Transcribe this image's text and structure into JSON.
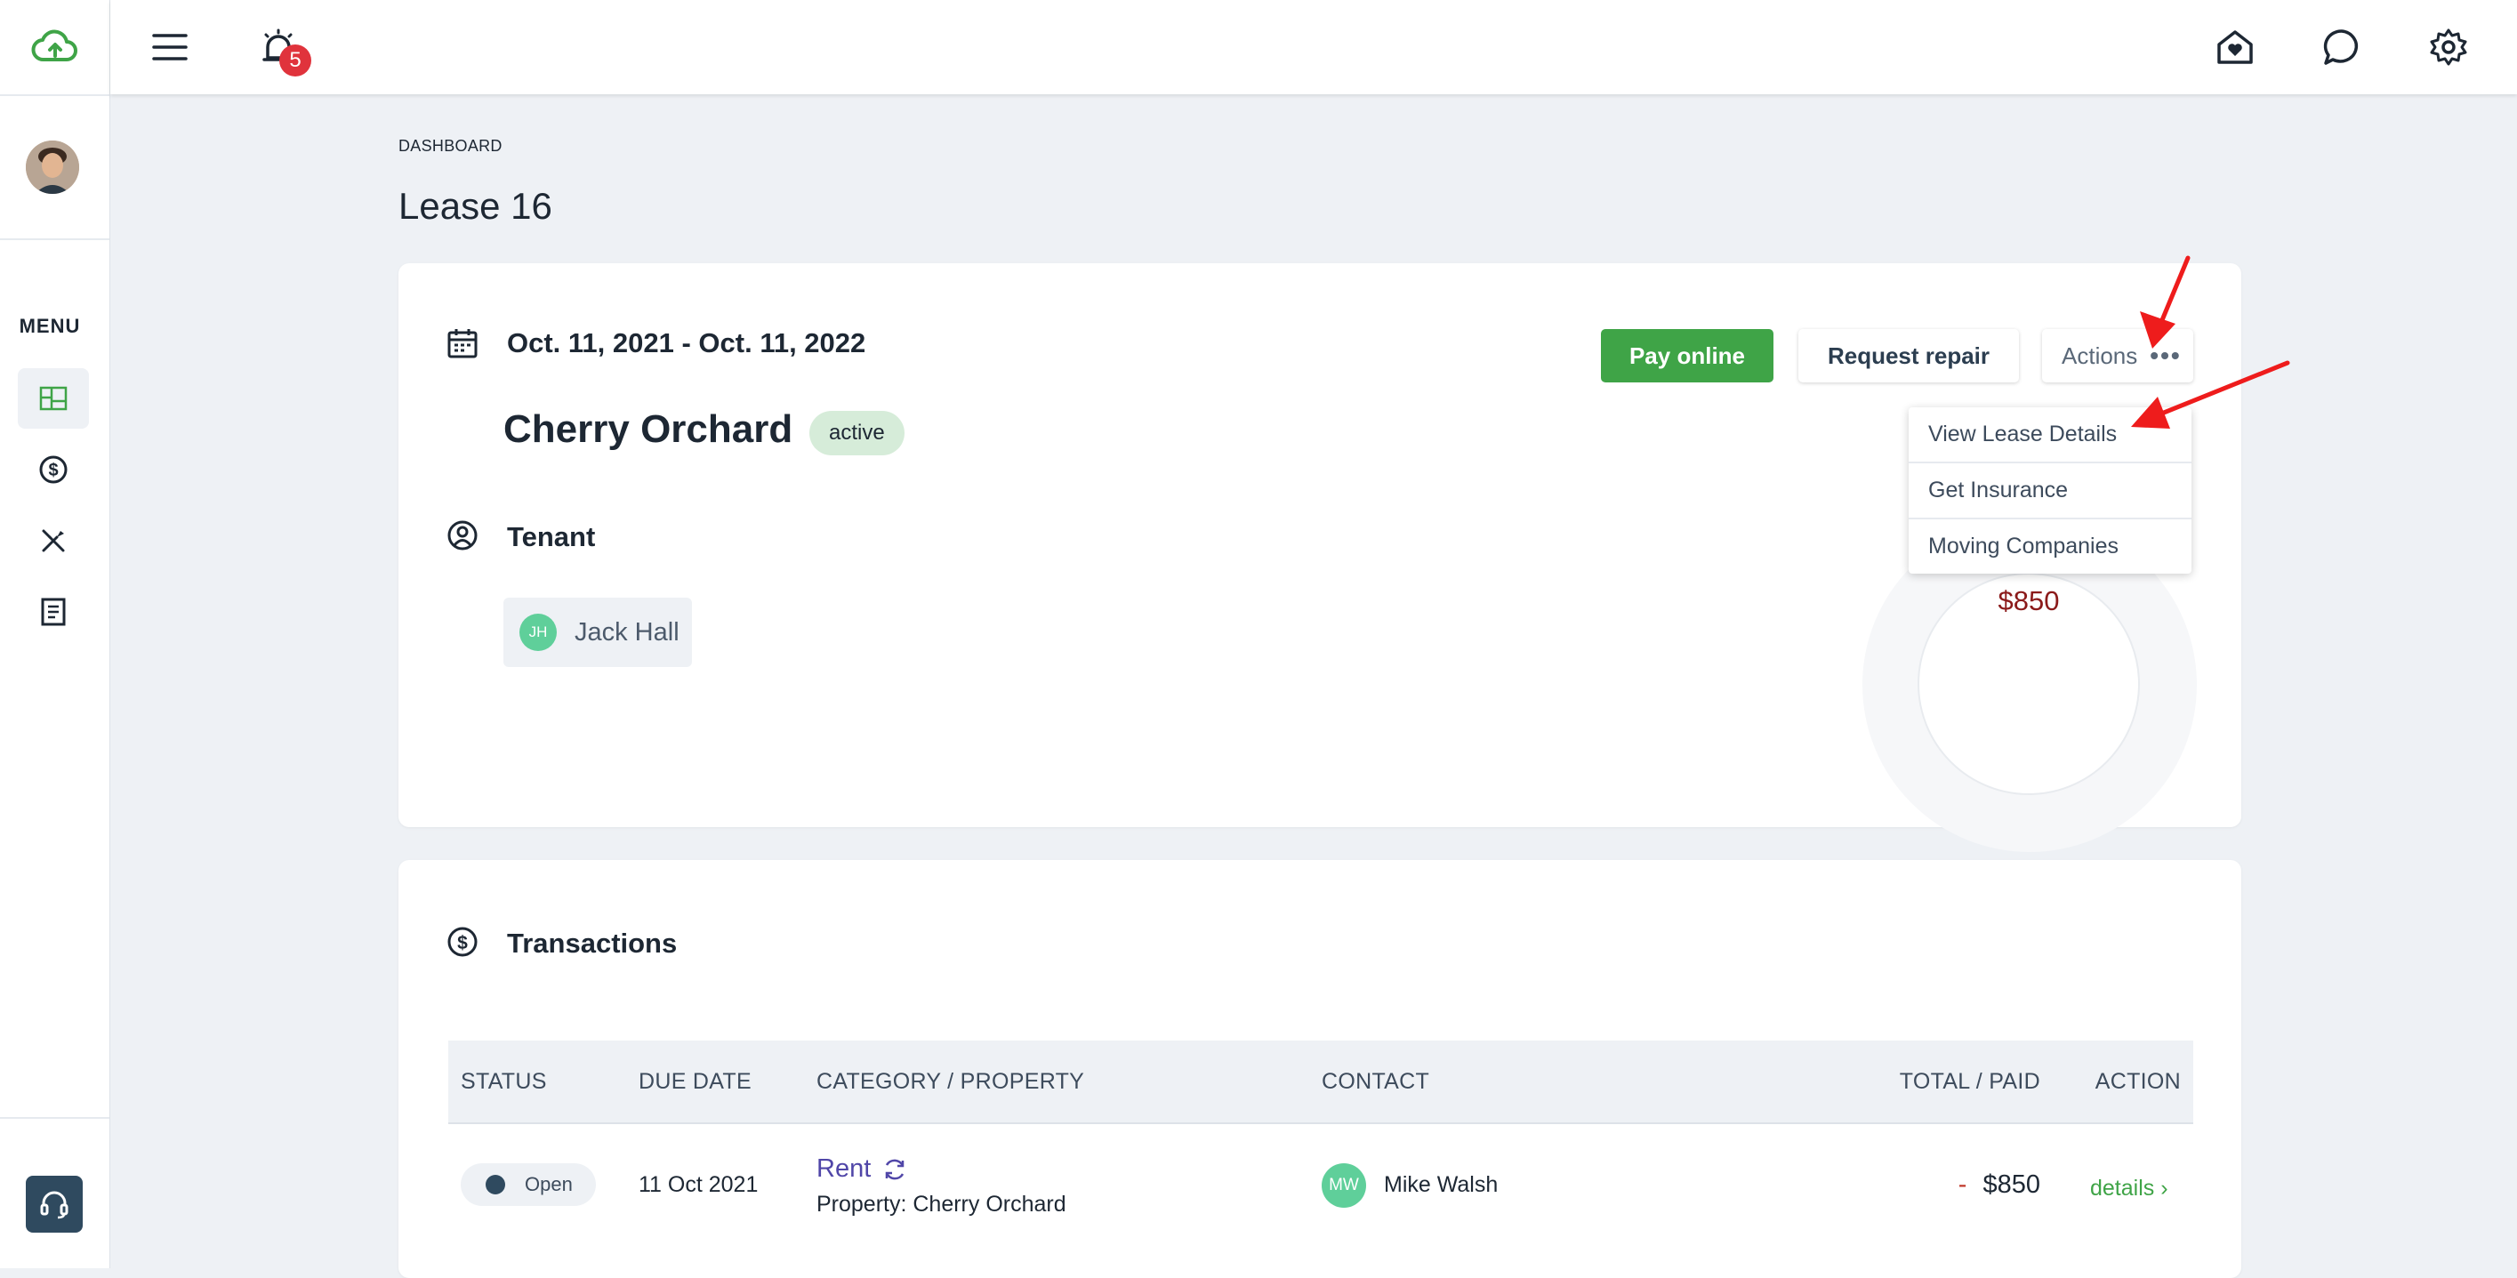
{
  "topbar": {
    "notification_count": "5"
  },
  "sidebar": {
    "menu_label": "MENU"
  },
  "breadcrumb": "DASHBOARD",
  "page_title": "Lease 16",
  "lease": {
    "date_range": "Oct. 11, 2021 - Oct. 11, 2022",
    "property_name": "Cherry Orchard",
    "status": "active",
    "tenant_heading": "Tenant",
    "tenant": {
      "initials": "JH",
      "name": "Jack Hall"
    },
    "balance": "$850"
  },
  "buttons": {
    "pay_online": "Pay online",
    "request_repair": "Request repair",
    "actions": "Actions",
    "actions_dots": "•••"
  },
  "actions_menu": [
    "View Lease Details",
    "Get Insurance",
    "Moving Companies"
  ],
  "transactions": {
    "heading": "Transactions",
    "columns": [
      "STATUS",
      "DUE DATE",
      "CATEGORY / PROPERTY",
      "CONTACT",
      "TOTAL / PAID",
      "ACTION"
    ],
    "rows": [
      {
        "status": "Open",
        "due_date": "11 Oct 2021",
        "category": "Rent",
        "property": "Property: Cherry Orchard",
        "contact_initials": "MW",
        "contact_name": "Mike Walsh",
        "total_sign": "-",
        "total": "$850",
        "action": "details ›"
      }
    ]
  },
  "colors": {
    "accent_green": "#3fa447",
    "badge_red": "#e0333c",
    "link_purple": "#5046a8",
    "background": "#eef1f5"
  }
}
